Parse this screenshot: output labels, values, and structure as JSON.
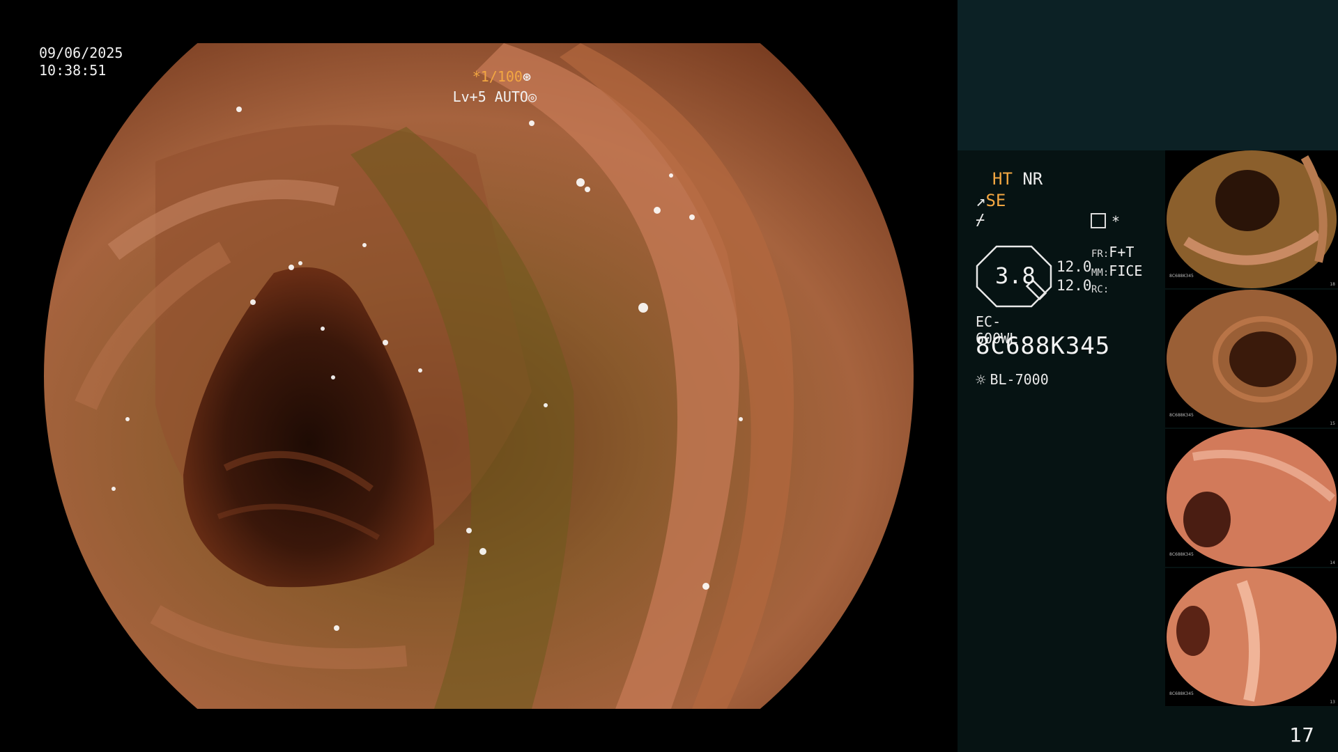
{
  "overlay": {
    "date": "09/06/2025",
    "time": "10:38:51",
    "shutter": "*1/100",
    "shutter_icon": "aperture-icon",
    "level": "Lv+5 AUTO",
    "level_icon": "auto-exposure-icon"
  },
  "panel": {
    "ht": "HT",
    "nr": "NR",
    "se_prefix": "↗",
    "se": "SE",
    "mode_symbol": "⌿",
    "memo_icon": "memo-icon",
    "memo_asterisk": "*",
    "gauge_value": "3.8",
    "values": [
      "12.0",
      "12.0"
    ],
    "labels": {
      "fr": "FR:",
      "fr_value": "F+T",
      "mm": "MM:",
      "mm_value": "FICE",
      "rc": "RC:"
    },
    "scope_model": "EC-600WL",
    "scope_serial": "8C688K345",
    "light_source_icon": "sun-icon",
    "light_source": "BL-7000"
  },
  "thumbnails": [
    {
      "serial": "8C688K345",
      "index": "18"
    },
    {
      "serial": "8C688K345",
      "index": "15"
    },
    {
      "serial": "8C688K345",
      "index": "14"
    },
    {
      "serial": "8C688K345",
      "index": "13"
    }
  ],
  "page_number": "17",
  "colors": {
    "accent_orange": "#f3a742",
    "panel_top": "#0c2125",
    "panel_bottom": "#061313"
  }
}
